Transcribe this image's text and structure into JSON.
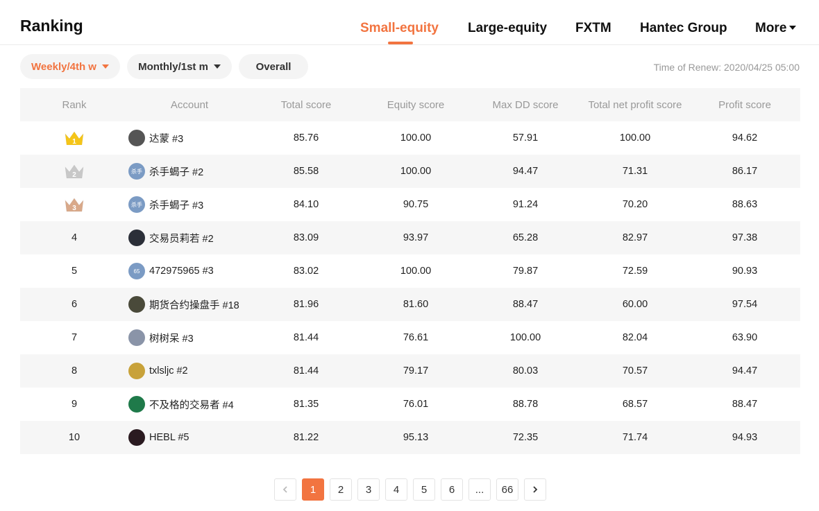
{
  "header": {
    "title": "Ranking",
    "tabs": [
      {
        "label": "Small-equity",
        "active": true
      },
      {
        "label": "Large-equity",
        "active": false
      },
      {
        "label": "FXTM",
        "active": false
      },
      {
        "label": "Hantec Group",
        "active": false
      },
      {
        "label": "More",
        "active": false
      }
    ]
  },
  "filters": {
    "weekly": "Weekly/4th w",
    "monthly": "Monthly/1st m",
    "overall": "Overall",
    "renew": "Time of Renew: 2020/04/25 05:00"
  },
  "table": {
    "columns": [
      "Rank",
      "Account",
      "Total score",
      "Equity score",
      "Max DD score",
      "Total net profit score",
      "Profit score"
    ],
    "rows": [
      {
        "rank": "1",
        "crown": "gold",
        "account": "达蒙 #3",
        "avatar_text": "",
        "avatar_color": "#555555",
        "total": "85.76",
        "equity": "100.00",
        "maxdd": "57.91",
        "net": "100.00",
        "profit": "94.62"
      },
      {
        "rank": "2",
        "crown": "silver",
        "account": "杀手蝎子 #2",
        "avatar_text": "杀手",
        "avatar_color": "#7b9bc4",
        "total": "85.58",
        "equity": "100.00",
        "maxdd": "94.47",
        "net": "71.31",
        "profit": "86.17"
      },
      {
        "rank": "3",
        "crown": "bronze",
        "account": "杀手蝎子 #3",
        "avatar_text": "杀手",
        "avatar_color": "#7b9bc4",
        "total": "84.10",
        "equity": "90.75",
        "maxdd": "91.24",
        "net": "70.20",
        "profit": "88.63"
      },
      {
        "rank": "4",
        "crown": "",
        "account": "交易员莉若 #2",
        "avatar_text": "",
        "avatar_color": "#2b2f38",
        "total": "83.09",
        "equity": "93.97",
        "maxdd": "65.28",
        "net": "82.97",
        "profit": "97.38"
      },
      {
        "rank": "5",
        "crown": "",
        "account": "472975965 #3",
        "avatar_text": "65",
        "avatar_color": "#7b9bc4",
        "total": "83.02",
        "equity": "100.00",
        "maxdd": "79.87",
        "net": "72.59",
        "profit": "90.93"
      },
      {
        "rank": "6",
        "crown": "",
        "account": "期货合约操盘手 #18",
        "avatar_text": "",
        "avatar_color": "#4a4a3a",
        "total": "81.96",
        "equity": "81.60",
        "maxdd": "88.47",
        "net": "60.00",
        "profit": "97.54"
      },
      {
        "rank": "7",
        "crown": "",
        "account": "树树呆 #3",
        "avatar_text": "",
        "avatar_color": "#8a94a8",
        "total": "81.44",
        "equity": "76.61",
        "maxdd": "100.00",
        "net": "82.04",
        "profit": "63.90"
      },
      {
        "rank": "8",
        "crown": "",
        "account": "txlsljc #2",
        "avatar_text": "",
        "avatar_color": "#c8a23a",
        "total": "81.44",
        "equity": "79.17",
        "maxdd": "80.03",
        "net": "70.57",
        "profit": "94.47"
      },
      {
        "rank": "9",
        "crown": "",
        "account": "不及格的交易者 #4",
        "avatar_text": "",
        "avatar_color": "#1f7a4a",
        "total": "81.35",
        "equity": "76.01",
        "maxdd": "88.78",
        "net": "68.57",
        "profit": "88.47"
      },
      {
        "rank": "10",
        "crown": "",
        "account": "HEBL #5",
        "avatar_text": "",
        "avatar_color": "#2a1a20",
        "total": "81.22",
        "equity": "95.13",
        "maxdd": "72.35",
        "net": "71.74",
        "profit": "94.93"
      }
    ]
  },
  "pagination": {
    "pages": [
      "1",
      "2",
      "3",
      "4",
      "5",
      "6",
      "...",
      "66"
    ],
    "current": "1",
    "prev_icon": "chevron-left-icon",
    "next_icon": "chevron-right-icon"
  },
  "colors": {
    "accent": "#f27440",
    "gold": "#f5c518",
    "silver": "#c8c8c8",
    "bronze": "#d9a98a"
  }
}
